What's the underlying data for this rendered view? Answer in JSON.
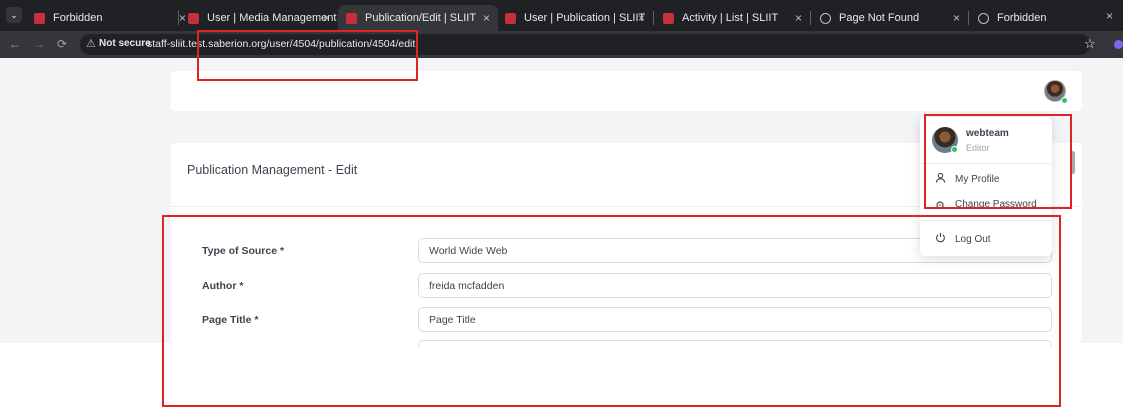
{
  "browser": {
    "tabs": [
      {
        "title": "Forbidden",
        "icon": "site-favicon"
      },
      {
        "title": "User | Media Management | Si",
        "icon": "site-favicon"
      },
      {
        "title": "Publication/Edit | SLIIT",
        "icon": "site-favicon"
      },
      {
        "title": "User | Publication | SLIIT",
        "icon": "site-favicon"
      },
      {
        "title": "Activity | List | SLIIT",
        "icon": "site-favicon"
      },
      {
        "title": "Page Not Found",
        "icon": "globe-icon"
      },
      {
        "title": "Forbidden",
        "icon": "globe-icon"
      }
    ],
    "not_secure": "Not secure",
    "url": "staff-sliit.test.saberion.org/user/4504/publication/4504/edit",
    "close_glyph": "×"
  },
  "user_menu": {
    "username": "webteam",
    "role": "Editor",
    "items": [
      {
        "label": "My Profile",
        "icon": "user-icon"
      },
      {
        "label": "Change Password",
        "icon": "gear-icon"
      },
      {
        "label": "Log Out",
        "icon": "power-icon"
      }
    ]
  },
  "card": {
    "title": "Publication Management - Edit"
  },
  "form": {
    "fields": [
      {
        "label": "Type of Source *",
        "value": "World Wide Web"
      },
      {
        "label": "Author *",
        "value": "freida mcfadden"
      },
      {
        "label": "Page Title *",
        "value": "Page Title"
      }
    ]
  },
  "colors": {
    "annotation": "#e02424",
    "online": "#28c76f",
    "browser_dark": "#202124"
  }
}
